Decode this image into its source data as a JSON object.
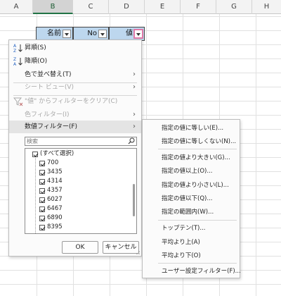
{
  "columns": [
    "A",
    "B",
    "C",
    "D",
    "E",
    "F",
    "G",
    "H"
  ],
  "header_cells": {
    "col_b": "名前",
    "col_c": "No",
    "col_d": "値"
  },
  "menu": {
    "sort_asc": "昇順(S)",
    "sort_desc": "降順(O)",
    "sort_by_color": "色で並べ替え(T)",
    "sheet_view": "シート ビュー(V)",
    "clear_filter": "\"値\" からフィルターをクリア(C)",
    "color_filter": "色フィルター(I)",
    "number_filter": "数値フィルター(F)",
    "search_placeholder": "検索",
    "list_items": [
      "(すべて選択)",
      "700",
      "3435",
      "4314",
      "4357",
      "6027",
      "6467",
      "6890",
      "8395"
    ],
    "ok_label": "OK",
    "cancel_label": "キャンセル"
  },
  "submenu": {
    "items": [
      "指定の値に等しい(E)...",
      "指定の値に等しくない(N)...",
      "指定の値より大きい(G)...",
      "指定の値以上(O)...",
      "指定の値より小さい(L)...",
      "指定の値以下(Q)...",
      "指定の範囲内(W)...",
      "トップテン(T)...",
      "平均より上(A)",
      "平均より下(O)",
      "ユーザー設定フィルター(F)..."
    ]
  },
  "colors": {
    "header_fill": "#bdd7ee",
    "filter_highlight": "#e07aa8",
    "selected_column_accent": "#217346"
  }
}
